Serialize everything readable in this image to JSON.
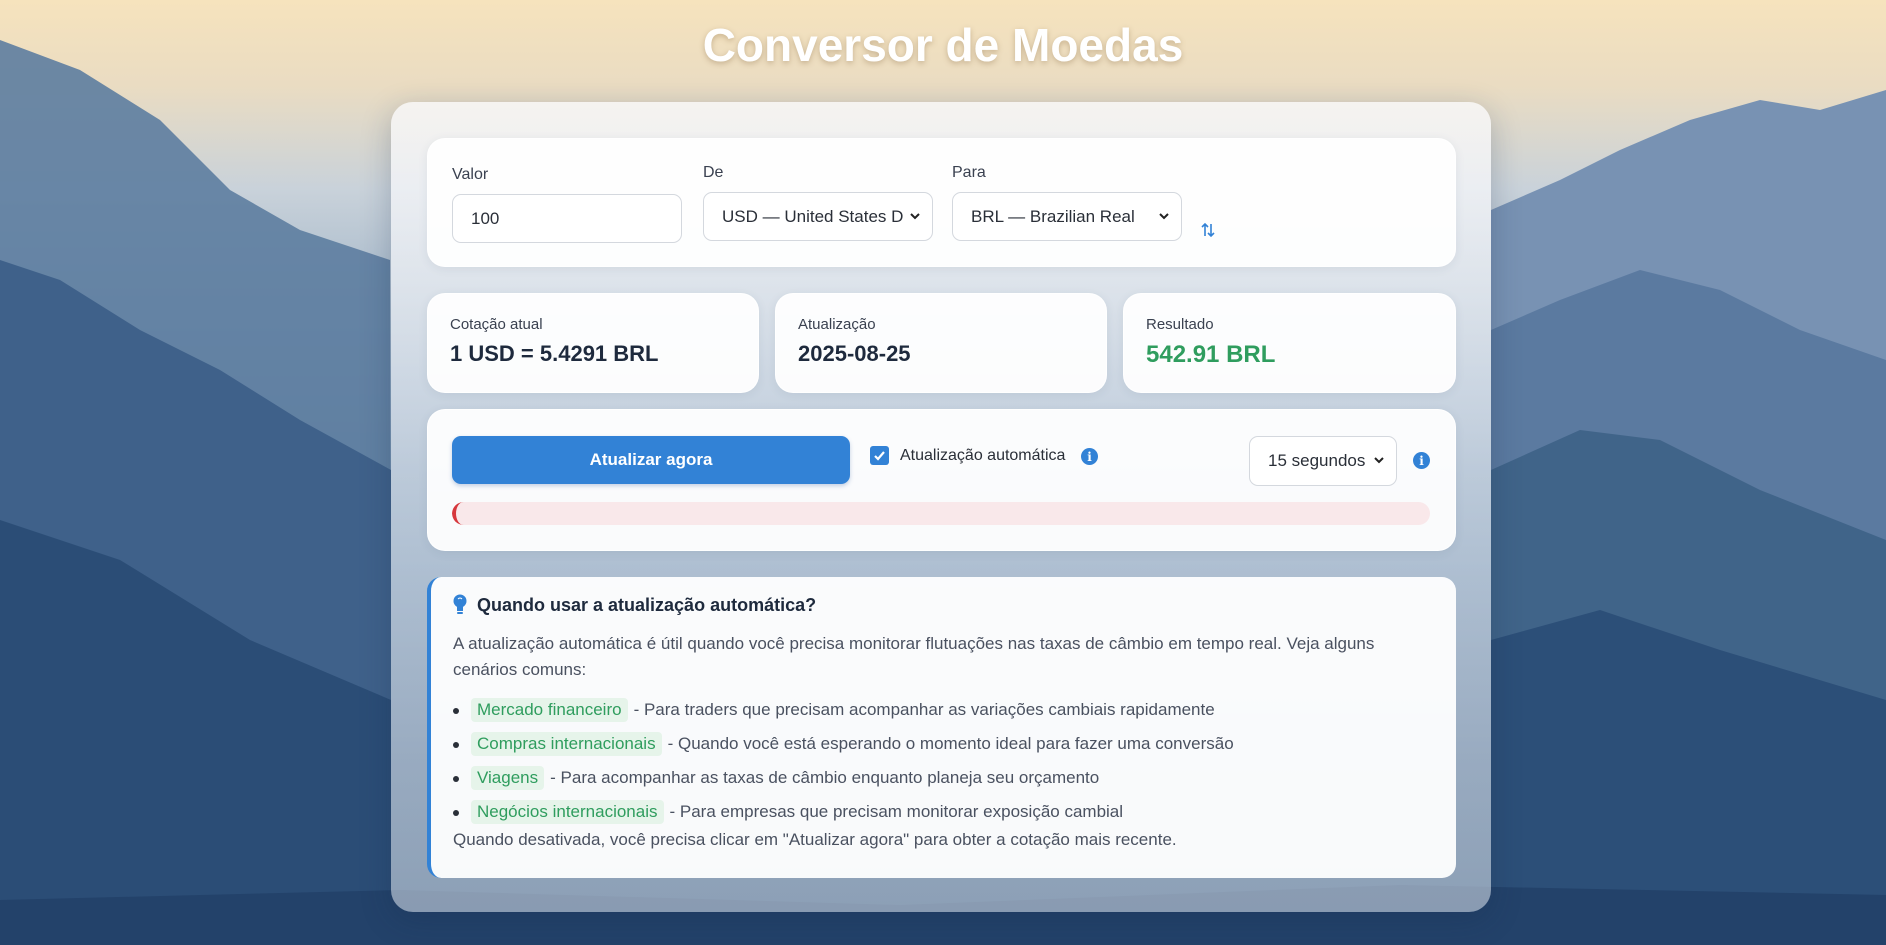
{
  "page": {
    "title": "Conversor de Moedas"
  },
  "converter": {
    "amount_label": "Valor",
    "amount_value": "100",
    "from_label": "De",
    "from_value": "USD — United States D",
    "to_label": "Para",
    "to_value": "BRL — Brazilian Real"
  },
  "stats": {
    "rate_label": "Cotação atual",
    "rate_value": "1 USD = 5.4291 BRL",
    "update_label": "Atualização",
    "update_value": "2025-08-25",
    "result_label": "Resultado",
    "result_value": "542.91 BRL"
  },
  "controls": {
    "refresh_button": "Atualizar agora",
    "auto_update_label": "Atualização automática",
    "auto_update_checked": true,
    "interval_value": "15 segundos",
    "progress_fraction": 0.01
  },
  "tips": {
    "title": "Quando usar a atualização automática?",
    "intro": "A atualização automática é útil quando você precisa monitorar flutuações nas taxas de câmbio em tempo real. Veja alguns cenários comuns:",
    "items": [
      {
        "tag": "Mercado financeiro",
        "text": "- Para traders que precisam acompanhar as variações cambiais rapidamente"
      },
      {
        "tag": "Compras internacionais",
        "text": "- Quando você está esperando o momento ideal para fazer uma conversão"
      },
      {
        "tag": "Viagens",
        "text": "- Para acompanhar as taxas de câmbio enquanto planeja seu orçamento"
      },
      {
        "tag": "Negócios internacionais",
        "text": "- Para empresas que precisam monitorar exposição cambial"
      }
    ],
    "footer": "Quando desativada, você precisa clicar em \"Atualizar agora\" para obter a cotação mais recente."
  },
  "colors": {
    "accent": "#3282d6",
    "result": "#2f9d5e",
    "progress": "#d6383d"
  }
}
